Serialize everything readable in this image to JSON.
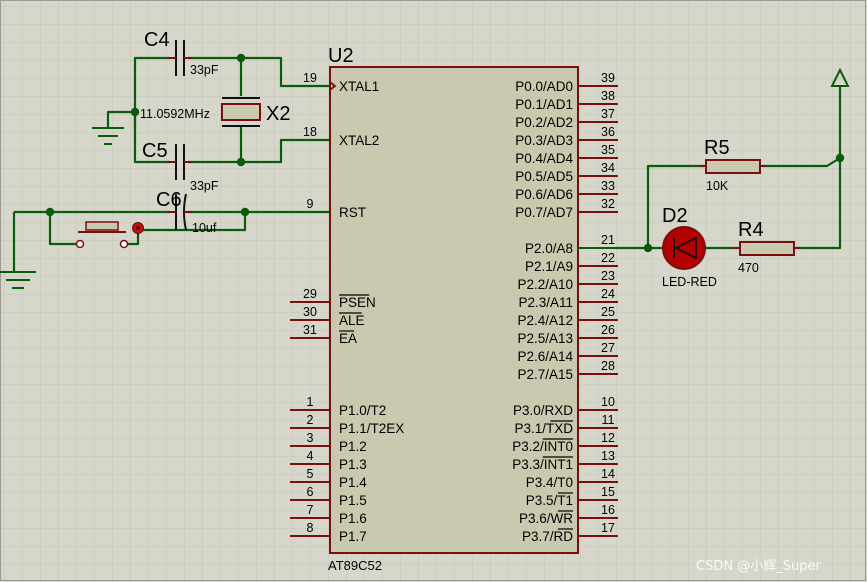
{
  "chip": {
    "ref": "U2",
    "part": "AT89C52",
    "left_pins": [
      {
        "num": "19",
        "name": "XTAL1"
      },
      {
        "num": "18",
        "name": "XTAL2"
      },
      {
        "num": "9",
        "name": "RST"
      },
      {
        "num": "29",
        "name": "PSEN",
        "overbar": true
      },
      {
        "num": "30",
        "name": "ALE",
        "overbar": true
      },
      {
        "num": "31",
        "name": "EA",
        "overbar": true
      },
      {
        "num": "1",
        "name": "P1.0/T2"
      },
      {
        "num": "2",
        "name": "P1.1/T2EX"
      },
      {
        "num": "3",
        "name": "P1.2"
      },
      {
        "num": "4",
        "name": "P1.3"
      },
      {
        "num": "5",
        "name": "P1.4"
      },
      {
        "num": "6",
        "name": "P1.5"
      },
      {
        "num": "7",
        "name": "P1.6"
      },
      {
        "num": "8",
        "name": "P1.7"
      }
    ],
    "right_pins": [
      {
        "num": "39",
        "name": "P0.0/AD0"
      },
      {
        "num": "38",
        "name": "P0.1/AD1"
      },
      {
        "num": "37",
        "name": "P0.2/AD2"
      },
      {
        "num": "36",
        "name": "P0.3/AD3"
      },
      {
        "num": "35",
        "name": "P0.4/AD4"
      },
      {
        "num": "34",
        "name": "P0.5/AD5"
      },
      {
        "num": "33",
        "name": "P0.6/AD6"
      },
      {
        "num": "32",
        "name": "P0.7/AD7"
      },
      {
        "num": "21",
        "name": "P2.0/A8"
      },
      {
        "num": "22",
        "name": "P2.1/A9"
      },
      {
        "num": "23",
        "name": "P2.2/A10"
      },
      {
        "num": "24",
        "name": "P2.3/A11"
      },
      {
        "num": "25",
        "name": "P2.4/A12"
      },
      {
        "num": "26",
        "name": "P2.5/A13"
      },
      {
        "num": "27",
        "name": "P2.6/A14"
      },
      {
        "num": "28",
        "name": "P2.7/A15"
      },
      {
        "num": "10",
        "name": "P3.0/RXD"
      },
      {
        "num": "11",
        "name": "P3.1/TXD",
        "bar_part": "TXD"
      },
      {
        "num": "12",
        "name": "P3.2/INT0",
        "bar_part": "INT0"
      },
      {
        "num": "13",
        "name": "P3.3/INT1",
        "bar_part": "INT1"
      },
      {
        "num": "14",
        "name": "P3.4/T0"
      },
      {
        "num": "15",
        "name": "P3.5/T1",
        "bar_part": "T1"
      },
      {
        "num": "16",
        "name": "P3.6/WR",
        "bar_part": "WR"
      },
      {
        "num": "17",
        "name": "P3.7/RD",
        "bar_part": "RD"
      }
    ]
  },
  "components": {
    "c4": {
      "ref": "C4",
      "value": "33pF"
    },
    "c5": {
      "ref": "C5",
      "value": "33pF"
    },
    "c6": {
      "ref": "C6",
      "value": "10uf"
    },
    "x2": {
      "ref": "X2",
      "value": "11.0592MHz"
    },
    "d2": {
      "ref": "D2",
      "value": "LED-RED"
    },
    "r4": {
      "ref": "R4",
      "value": "470"
    },
    "r5": {
      "ref": "R5",
      "value": "10K"
    }
  },
  "watermark": "CSDN @小辉_Super",
  "colors": {
    "background": "#d6d6cb",
    "grid": "#c4c4b8",
    "wire": "#0a5c0a",
    "component": "#7a0d0d",
    "chip_fill": "#c9c9b0",
    "led_fill": "#b40000"
  }
}
